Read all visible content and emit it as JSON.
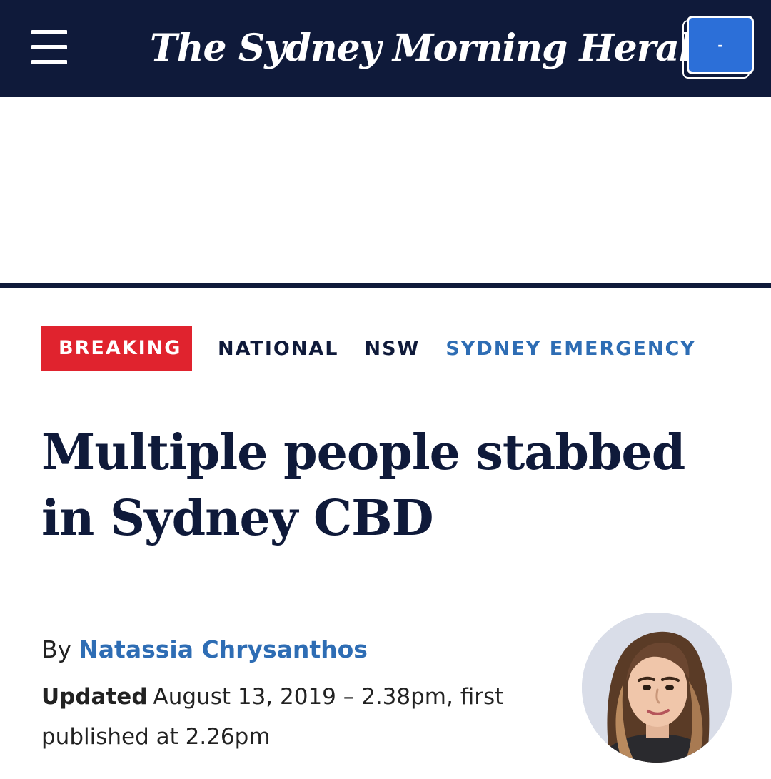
{
  "header": {
    "masthead": "The Sydney Morning Herald",
    "menu_icon": "hamburger-menu-icon",
    "account_button_label": "-"
  },
  "colors": {
    "header_bg": "#0f1a3a",
    "breaking_bg": "#e0232e",
    "accent_blue": "#2e6db4",
    "account_button_bg": "#2c6fd8"
  },
  "tags": {
    "breaking": "BREAKING",
    "items": [
      "NATIONAL",
      "NSW",
      "SYDNEY EMERGENCY"
    ]
  },
  "article": {
    "headline": "Multiple people stabbed in Sydney CBD",
    "byline_prefix": "By",
    "author": "Natassia Chrysanthos",
    "updated_label": "Updated",
    "updated_text": "August 13, 2019 – 2.38pm, first published at 2.26pm"
  }
}
